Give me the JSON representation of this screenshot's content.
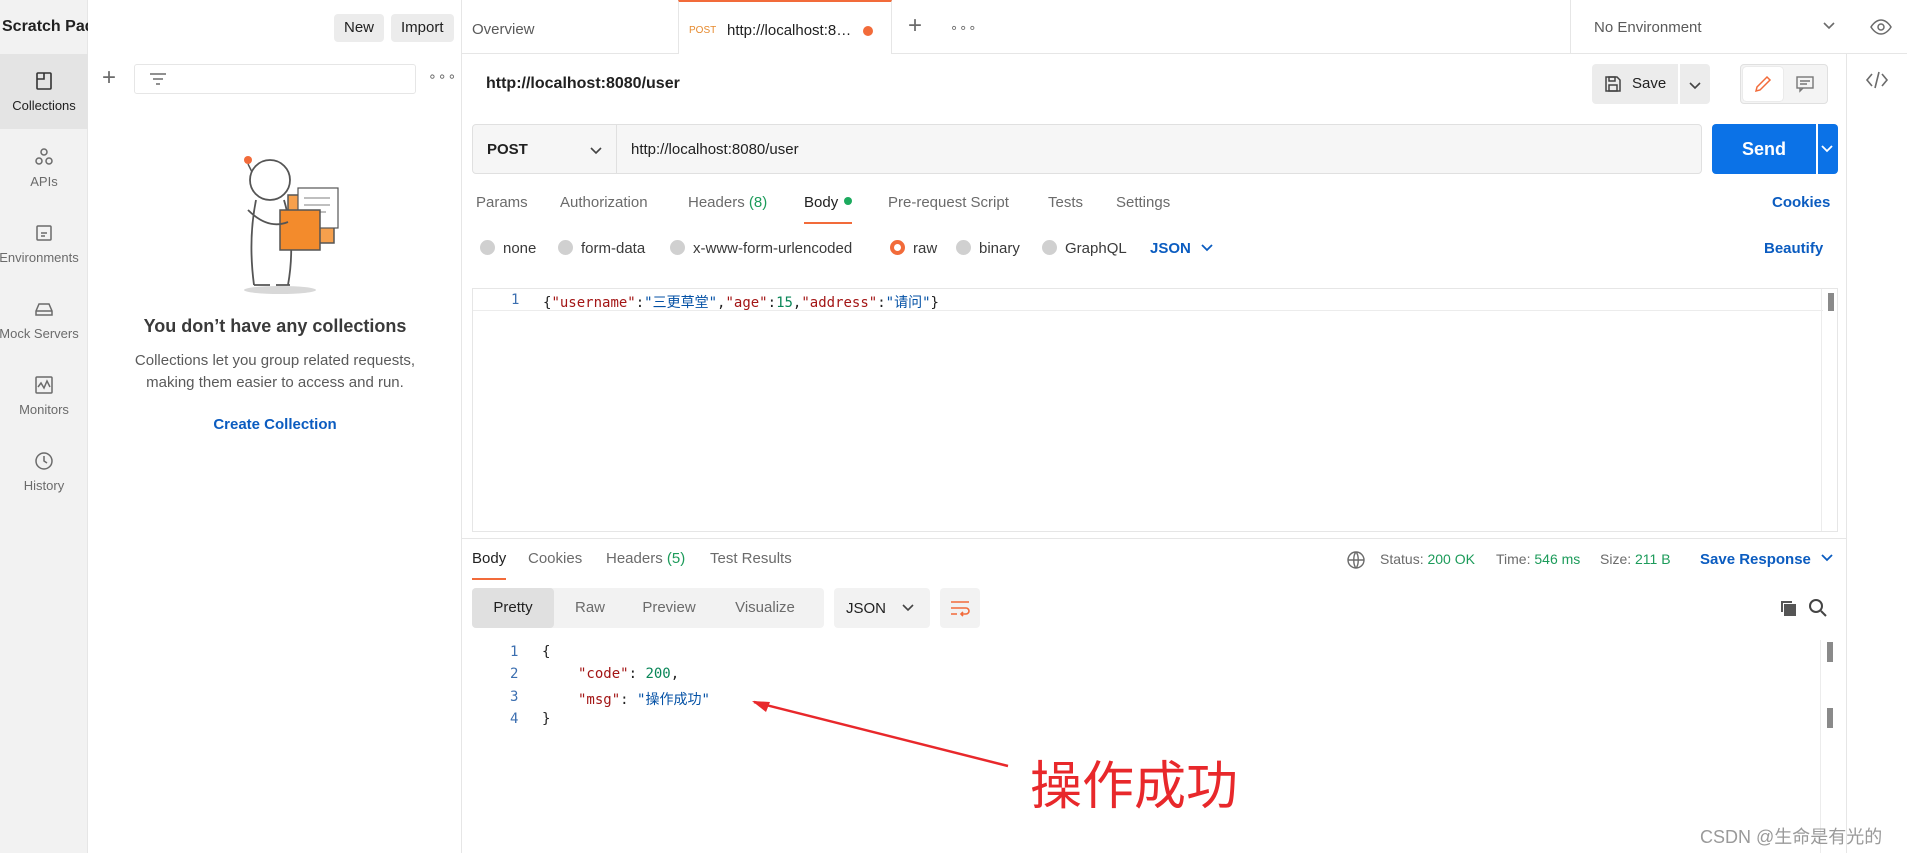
{
  "workspace": {
    "title": "Scratch Pad",
    "new_label": "New",
    "import_label": "Import"
  },
  "rail": [
    {
      "label": "Collections",
      "icon": "collections-icon",
      "active": true
    },
    {
      "label": "APIs",
      "icon": "apis-icon"
    },
    {
      "label": "Environments",
      "icon": "environments-icon"
    },
    {
      "label": "Mock Servers",
      "icon": "mock-servers-icon"
    },
    {
      "label": "Monitors",
      "icon": "monitors-icon"
    },
    {
      "label": "History",
      "icon": "history-icon"
    }
  ],
  "collections": {
    "empty_title": "You don’t have any collections",
    "empty_desc": "Collections let you group related requests, making them easier to access and run.",
    "create_label": "Create Collection"
  },
  "tabs": {
    "overview": "Overview",
    "active_method": "POST",
    "active_url": "http://localhost:8…"
  },
  "environment": {
    "selected": "No Environment"
  },
  "request": {
    "title": "http://localhost:8080/user",
    "save_label": "Save",
    "method": "POST",
    "url": "http://localhost:8080/user",
    "send_label": "Send",
    "tabs": [
      "Params",
      "Authorization",
      "Headers",
      "Body",
      "Pre-request Script",
      "Tests",
      "Settings"
    ],
    "headers_count": "(8)",
    "cookies_label": "Cookies",
    "body_types": [
      "none",
      "form-data",
      "x-www-form-urlencoded",
      "raw",
      "binary",
      "GraphQL"
    ],
    "body_format": "JSON",
    "beautify_label": "Beautify",
    "body_line_no": "1",
    "body": {
      "open": "{",
      "k1": "\"username\"",
      "v1": "\"三更草堂\"",
      "k2": "\"age\"",
      "v2": "15",
      "k3": "\"address\"",
      "v3": "\"请问\"",
      "close": "}"
    }
  },
  "response": {
    "tabs": [
      "Body",
      "Cookies",
      "Headers",
      "Test Results"
    ],
    "headers_count": "(5)",
    "status_label": "Status:",
    "status_value": "200 OK",
    "time_label": "Time:",
    "time_value": "546 ms",
    "size_label": "Size:",
    "size_value": "211 B",
    "save_label": "Save Response",
    "views": [
      "Pretty",
      "Raw",
      "Preview",
      "Visualize"
    ],
    "format": "JSON",
    "line_numbers": [
      "1",
      "2",
      "3",
      "4"
    ],
    "body": {
      "open": "{",
      "code_key": "\"code\"",
      "code_val": "200",
      "msg_key": "\"msg\"",
      "msg_val": "\"操作成功\"",
      "close": "}"
    }
  },
  "annotation": {
    "text": "操作成功",
    "color": "#e8282b"
  },
  "watermark": "CSDN @生命是有光的",
  "colors": {
    "accent": "#f26b3a",
    "primary": "#0b72e7",
    "link": "#0b5cc0",
    "success": "#1c9b5a"
  }
}
